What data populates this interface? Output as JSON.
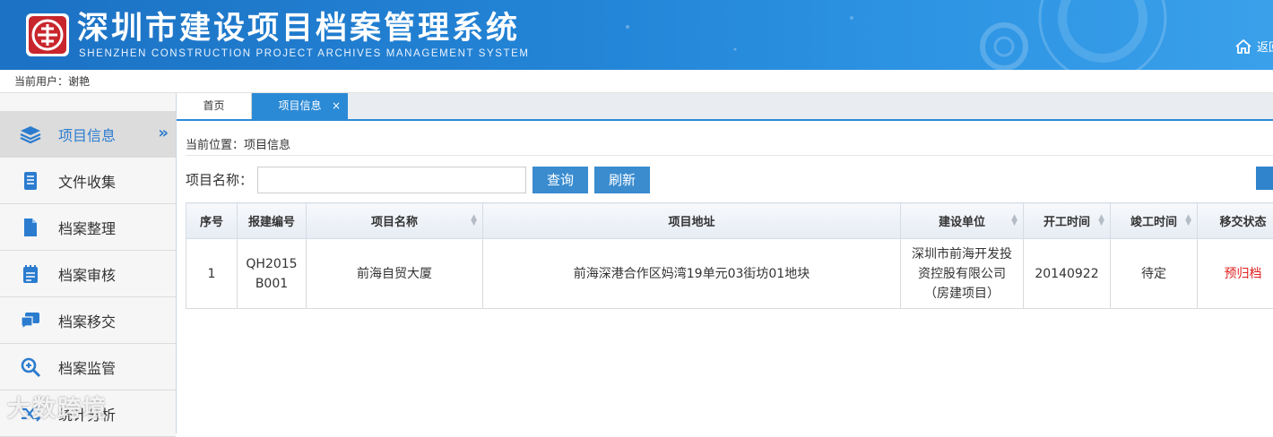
{
  "header": {
    "title": "深圳市建设项目档案管理系统",
    "subtitle": "SHENZHEN CONSTRUCTION PROJECT ARCHIVES MANAGEMENT SYSTEM",
    "home_label": "返回"
  },
  "userbar": {
    "label": "当前用户：谢艳"
  },
  "sidebar": {
    "items": [
      {
        "label": "项目信息",
        "icon": "layers-icon"
      },
      {
        "label": "文件收集",
        "icon": "document-icon"
      },
      {
        "label": "档案整理",
        "icon": "file-icon"
      },
      {
        "label": "档案审核",
        "icon": "notepad-icon"
      },
      {
        "label": "档案移交",
        "icon": "chat-icon"
      },
      {
        "label": "档案监管",
        "icon": "zoom-icon"
      },
      {
        "label": "统计分析",
        "icon": "shuffle-icon"
      }
    ],
    "arrow": "»"
  },
  "tabs": {
    "home": "首页",
    "current": "项目信息",
    "close": "×"
  },
  "content": {
    "breadcrumb": "当前位置：项目信息",
    "search_label": "项目名称：",
    "search_value": "",
    "query_button": "查询",
    "refresh_button": "刷新"
  },
  "table": {
    "headers": [
      "序号",
      "报建编号",
      "项目名称",
      "项目地址",
      "建设单位",
      "开工时间",
      "竣工时间",
      "移交状态"
    ],
    "rows": [
      {
        "index": "1",
        "code": "QH2015 B001",
        "name": "前海自贸大厦",
        "address": "前海深港合作区妈湾19单元03街坊01地块",
        "builder": "深圳市前海开发投资控股有限公司（房建项目）",
        "start": "20140922",
        "finish": "待定",
        "status": "预归档"
      }
    ]
  },
  "watermark": "大数跨境",
  "colors": {
    "header_blue": "#2384d6",
    "accent": "#2b8ad6",
    "status_red": "#e02020"
  }
}
